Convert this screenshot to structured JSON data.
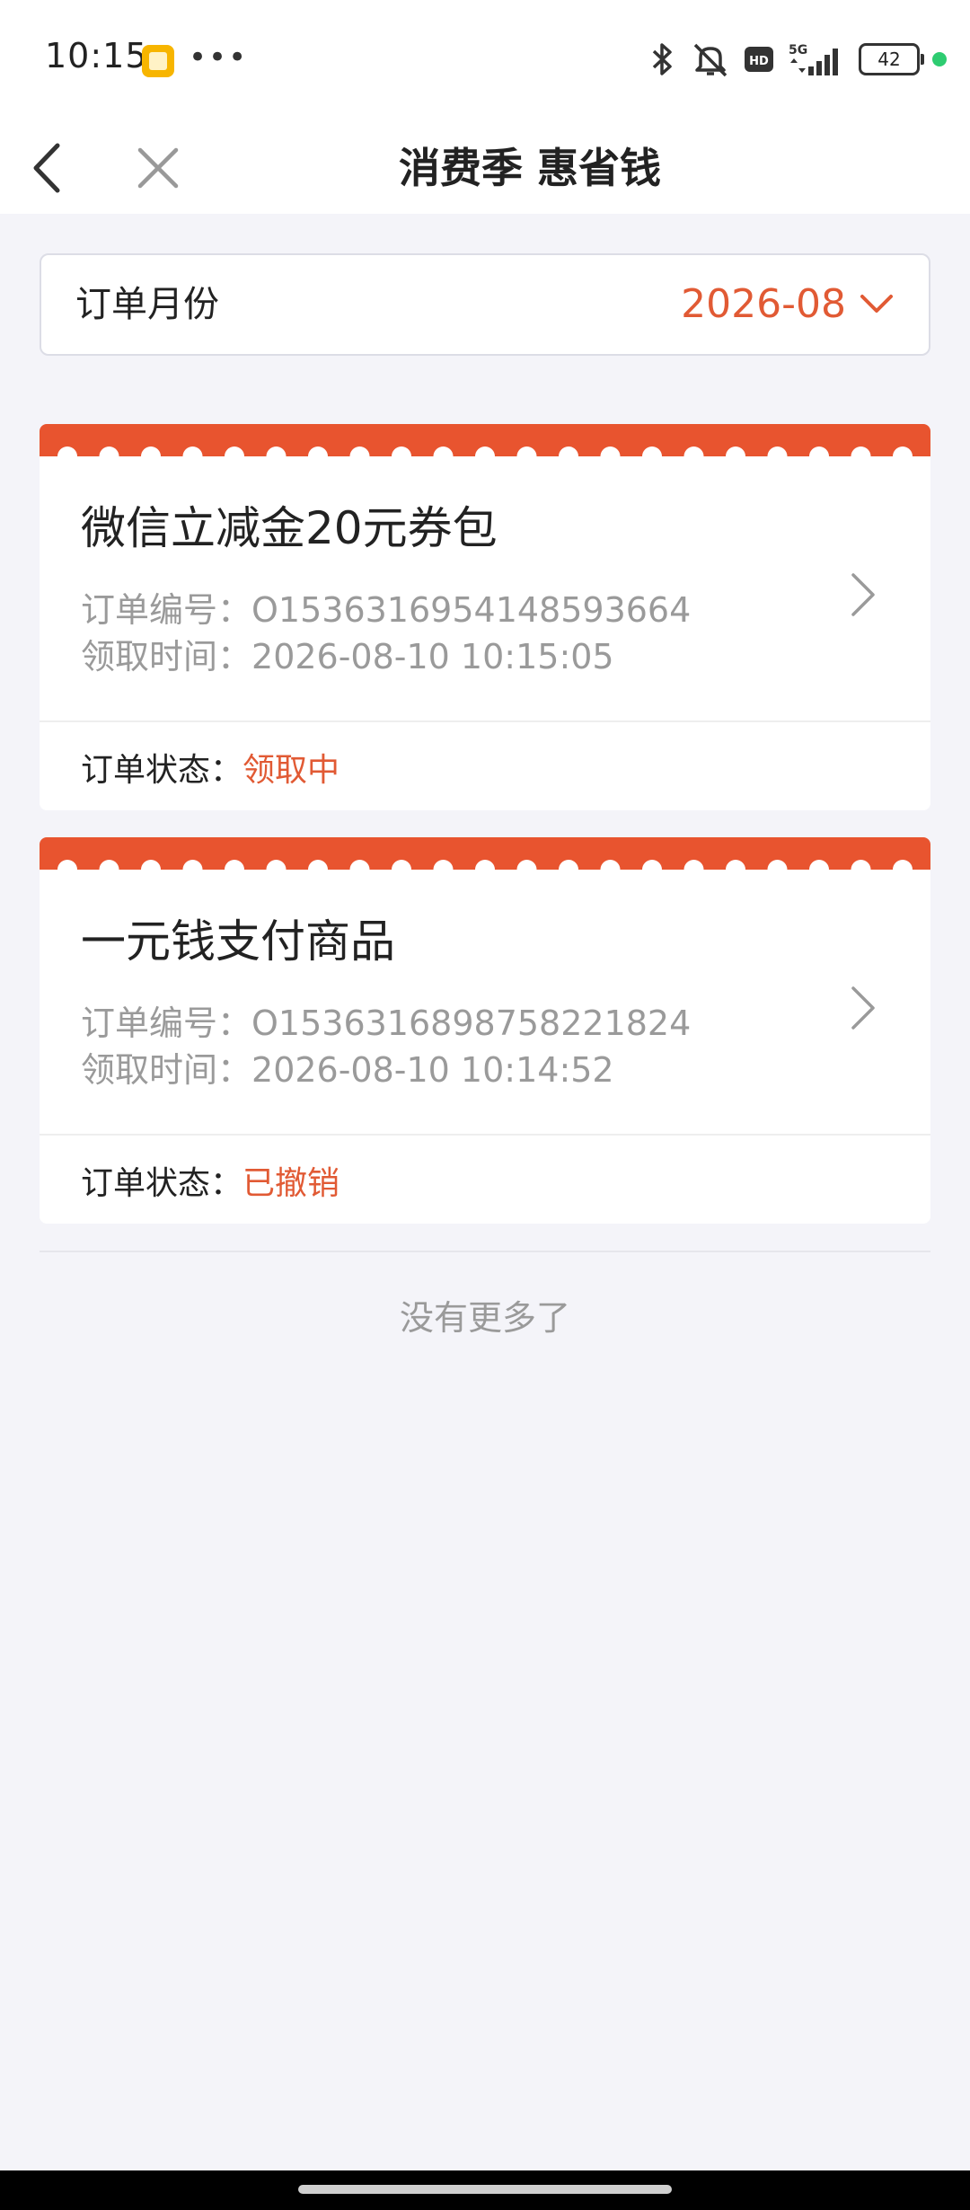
{
  "status_bar": {
    "time": "10:15",
    "dots": "•••",
    "hd_badge": "HD",
    "network": "5G",
    "battery": "42",
    "app_icon": "gallery-app-icon"
  },
  "nav": {
    "title": "消费季 惠省钱",
    "back_icon": "chevron-left-icon",
    "close_icon": "close-icon"
  },
  "month_selector": {
    "label": "订单月份",
    "value": "2026-08"
  },
  "orders": [
    {
      "title": "微信立减金20元券包",
      "order_no_label": "订单编号：",
      "order_no": "O1536316954148593664",
      "time_label": "领取时间：",
      "time": "2026-08-10 10:15:05",
      "status_label": "订单状态：",
      "status": "领取中"
    },
    {
      "title": "一元钱支付商品",
      "order_no_label": "订单编号：",
      "order_no": "O1536316898758221824",
      "time_label": "领取时间：",
      "time": "2026-08-10 10:14:52",
      "status_label": "订单状态：",
      "status": "已撤销"
    }
  ],
  "footer": {
    "no_more": "没有更多了"
  },
  "colors": {
    "accent": "#e15a34",
    "background": "#f4f4f9"
  }
}
